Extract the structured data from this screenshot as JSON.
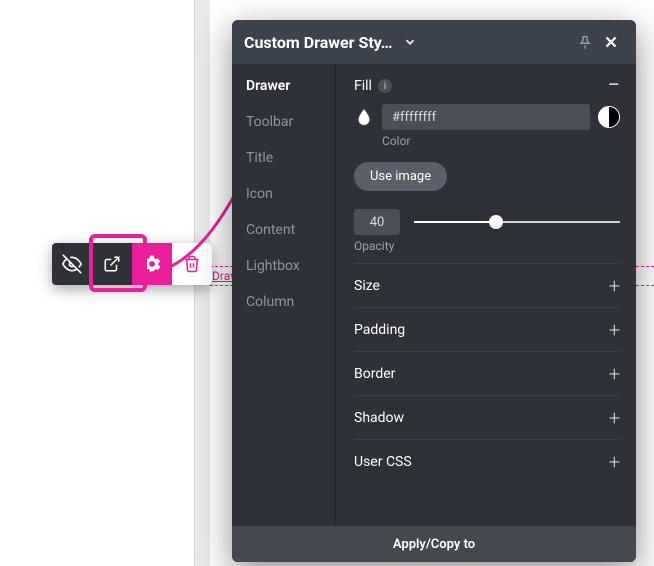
{
  "drawer_label": "Drawer",
  "toolbar_icons": [
    "eye-off-icon",
    "open-external-icon",
    "gear-icon",
    "trash-icon"
  ],
  "panel": {
    "title": "Custom Drawer Sty…",
    "sidebar": {
      "items": [
        {
          "label": "Drawer",
          "active": true
        },
        {
          "label": "Toolbar"
        },
        {
          "label": "Title"
        },
        {
          "label": "Icon"
        },
        {
          "label": "Content"
        },
        {
          "label": "Lightbox"
        },
        {
          "label": "Column"
        }
      ]
    },
    "fill": {
      "section_label": "Fill",
      "color_value": "#ffffffff",
      "color_label": "Color",
      "use_image_label": "Use image",
      "opacity_value": "40",
      "opacity_label": "Opacity"
    },
    "accordions": [
      "Size",
      "Padding",
      "Border",
      "Shadow",
      "User CSS"
    ],
    "footer_label": "Apply/Copy to"
  }
}
